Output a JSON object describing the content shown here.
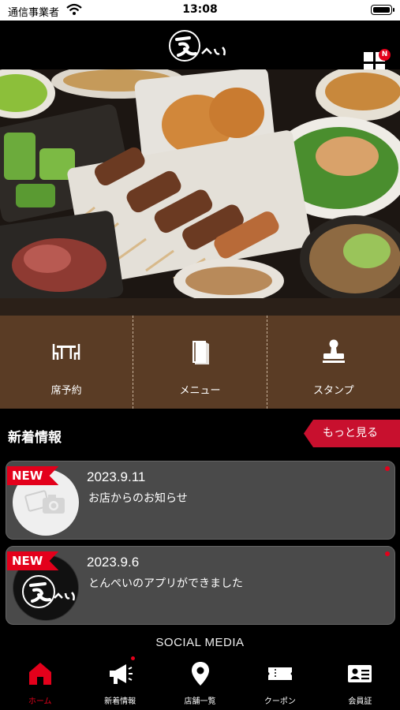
{
  "status_bar": {
    "carrier": "通信事業者",
    "time": "13:08"
  },
  "header": {
    "logo_text": "えぺい",
    "menu_badge": "N"
  },
  "quick_actions": [
    {
      "label": "席予約",
      "icon": "table-reservation-icon"
    },
    {
      "label": "メニュー",
      "icon": "menu-book-icon"
    },
    {
      "label": "スタンプ",
      "icon": "stamp-icon"
    }
  ],
  "news": {
    "title": "新着情報",
    "more_label": "もっと見る",
    "items": [
      {
        "badge": "NEW",
        "date": "2023.9.11",
        "headline": "お店からのお知らせ",
        "thumb": "camera-placeholder-icon"
      },
      {
        "badge": "NEW",
        "date": "2023.9.6",
        "headline": "とんぺいのアプリができました",
        "thumb": "store-logo"
      }
    ]
  },
  "social": {
    "title": "SOCIAL MEDIA"
  },
  "tabs": [
    {
      "label": "ホーム",
      "icon": "home-icon",
      "active": true
    },
    {
      "label": "新着情報",
      "icon": "megaphone-icon",
      "active": false
    },
    {
      "label": "店舗一覧",
      "icon": "map-pin-icon",
      "active": false
    },
    {
      "label": "クーポン",
      "icon": "coupon-icon",
      "active": false
    },
    {
      "label": "会員証",
      "icon": "member-card-icon",
      "active": false
    }
  ],
  "colors": {
    "accent": "#e3001b",
    "brown": "#5a3c25",
    "card": "#4a4a4a"
  }
}
